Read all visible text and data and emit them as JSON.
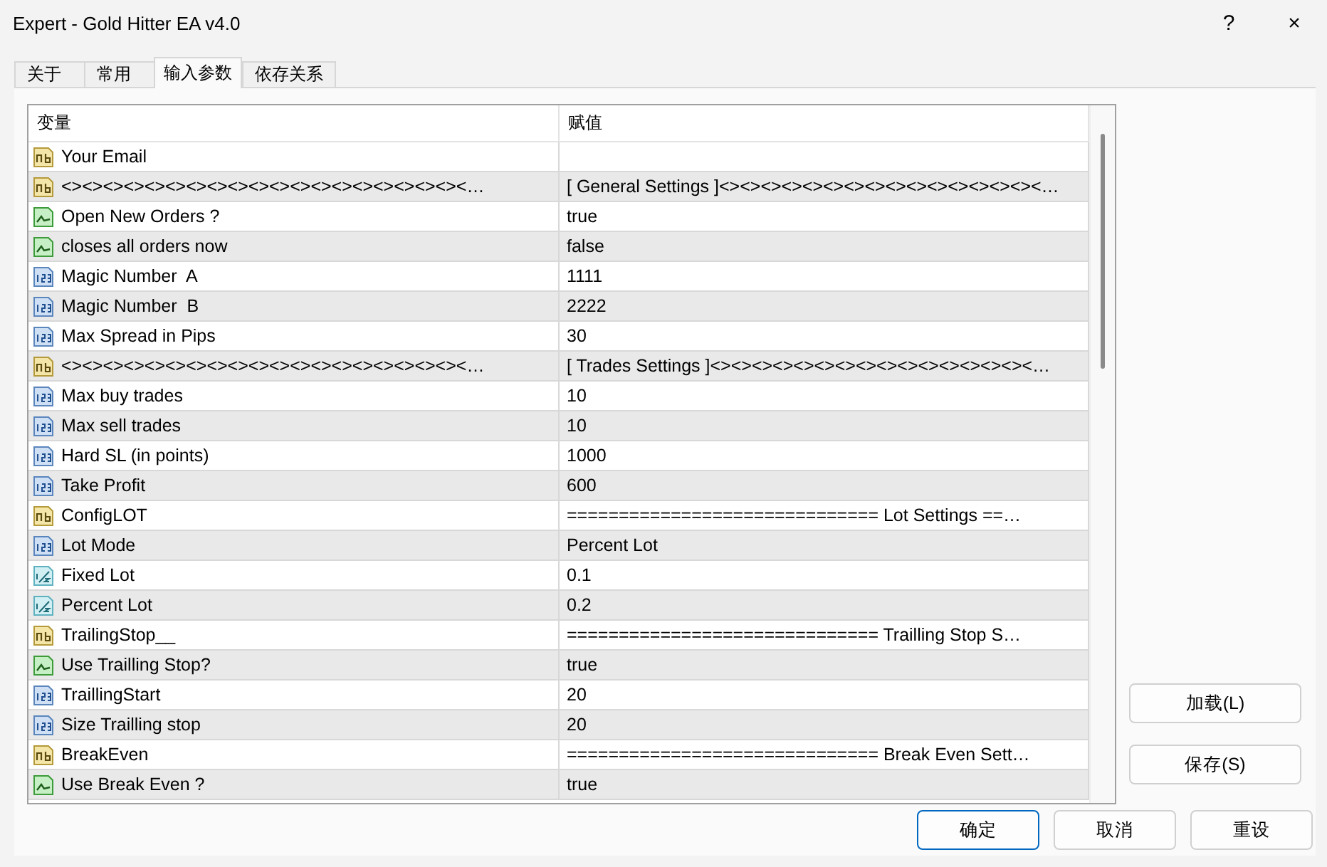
{
  "window": {
    "title": "Expert - Gold Hitter EA v4.0",
    "help": "?",
    "close": "×"
  },
  "tabs": [
    {
      "label": "关于",
      "selected": false
    },
    {
      "label": "常用",
      "selected": false
    },
    {
      "label": "输入参数",
      "selected": true
    },
    {
      "label": "依存关系",
      "selected": false
    }
  ],
  "table": {
    "columns": [
      "变量",
      "赋值"
    ],
    "rows": [
      {
        "kind": "string",
        "name": "Your Email",
        "value": ""
      },
      {
        "kind": "string",
        "name": "<><><><><><><><><><><><><><><><><><><><…",
        "value": "[ General Settings ]<><><><><><><><><><><><><><><><…"
      },
      {
        "kind": "bool",
        "name": "Open New Orders ?",
        "value": "true"
      },
      {
        "kind": "bool",
        "name": "closes all orders now",
        "value": "false"
      },
      {
        "kind": "int",
        "name": "Magic Number  A",
        "value": "1111"
      },
      {
        "kind": "int",
        "name": "Magic Number  B",
        "value": "2222"
      },
      {
        "kind": "int",
        "name": "Max Spread in Pips",
        "value": "30"
      },
      {
        "kind": "string",
        "name": "<><><><><><><><><><><><><><><><><><><><…",
        "value": "[ Trades Settings ]<><><><><><><><><><><><><><><><…"
      },
      {
        "kind": "int",
        "name": "Max buy trades",
        "value": "10"
      },
      {
        "kind": "int",
        "name": "Max sell trades",
        "value": "10"
      },
      {
        "kind": "int",
        "name": "Hard SL (in points)",
        "value": "1000"
      },
      {
        "kind": "int",
        "name": "Take Profit",
        "value": "600"
      },
      {
        "kind": "string",
        "name": "ConfigLOT",
        "value": "============================== Lot Settings ==…"
      },
      {
        "kind": "int",
        "name": "Lot Mode",
        "value": "Percent Lot"
      },
      {
        "kind": "double",
        "name": "Fixed Lot",
        "value": "0.1"
      },
      {
        "kind": "double",
        "name": "Percent Lot",
        "value": "0.2"
      },
      {
        "kind": "string",
        "name": "TrailingStop__",
        "value": "============================== Trailling Stop S…"
      },
      {
        "kind": "bool",
        "name": "Use Trailling Stop?",
        "value": "true"
      },
      {
        "kind": "int",
        "name": "TraillingStart",
        "value": "20"
      },
      {
        "kind": "int",
        "name": "Size Trailling stop",
        "value": "20"
      },
      {
        "kind": "string",
        "name": "BreakEven",
        "value": "============================== Break Even Sett…"
      },
      {
        "kind": "bool",
        "name": "Use Break Even ?",
        "value": "true"
      }
    ]
  },
  "side_buttons": [
    "加载(L)",
    "保存(S)"
  ],
  "buttons": [
    {
      "label": "确定",
      "selected": true
    },
    {
      "label": "取消",
      "selected": false
    },
    {
      "label": "重设",
      "selected": false
    }
  ]
}
